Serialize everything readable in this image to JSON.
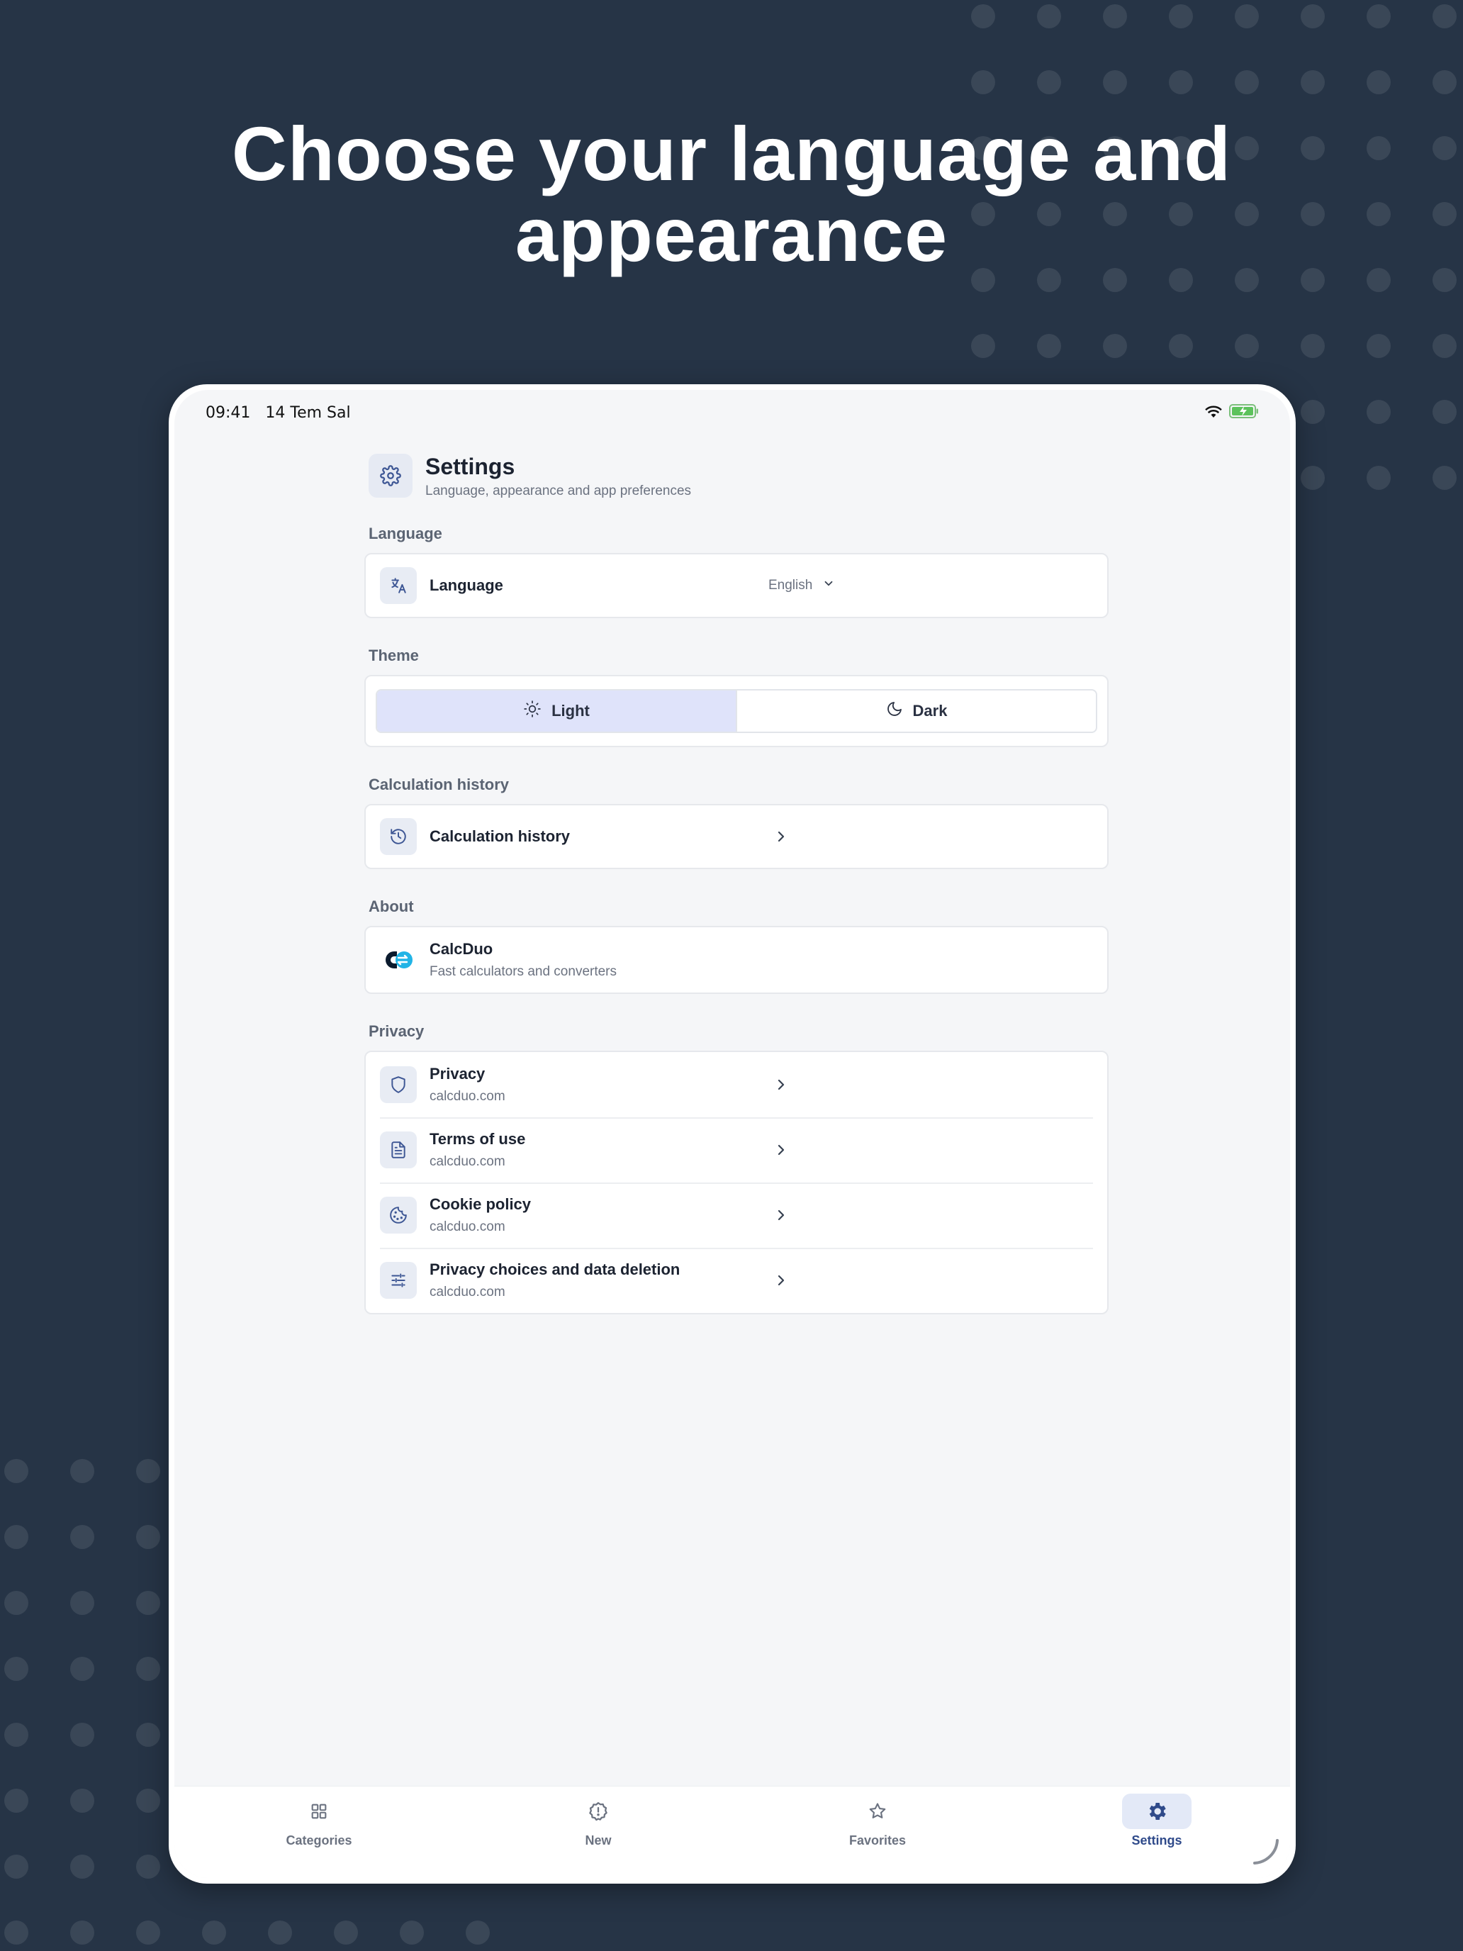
{
  "headline": {
    "line1": "Choose your language and",
    "line2": "appearance"
  },
  "status_bar": {
    "time": "09:41",
    "date": "14 Tem Sal",
    "wifi_icon": "wifi-icon",
    "battery_icon": "battery-charging-icon"
  },
  "header": {
    "icon": "gear-icon",
    "title": "Settings",
    "subtitle": "Language, appearance and app preferences"
  },
  "sections": {
    "language": {
      "label": "Language",
      "row_title": "Language",
      "value": "English",
      "icon": "translate-icon"
    },
    "theme": {
      "label": "Theme",
      "options": [
        {
          "label": "Light",
          "icon": "sun-icon",
          "selected": true
        },
        {
          "label": "Dark",
          "icon": "moon-icon",
          "selected": false
        }
      ]
    },
    "history": {
      "label": "Calculation history",
      "row_title": "Calculation history",
      "icon": "history-icon"
    },
    "about": {
      "label": "About",
      "app_name": "CalcDuo",
      "tagline": "Fast calculators and converters",
      "logo": "calcduo-logo"
    },
    "privacy": {
      "label": "Privacy",
      "items": [
        {
          "title": "Privacy",
          "sub": "calcduo.com",
          "icon": "shield-icon"
        },
        {
          "title": "Terms of use",
          "sub": "calcduo.com",
          "icon": "document-icon"
        },
        {
          "title": "Cookie policy",
          "sub": "calcduo.com",
          "icon": "cookie-icon"
        },
        {
          "title": "Privacy choices and data deletion",
          "sub": "calcduo.com",
          "icon": "sliders-icon"
        }
      ]
    }
  },
  "tabbar": {
    "tabs": [
      {
        "label": "Categories",
        "icon": "grid-icon",
        "active": false
      },
      {
        "label": "New",
        "icon": "badge-alert-icon",
        "active": false
      },
      {
        "label": "Favorites",
        "icon": "star-icon",
        "active": false
      },
      {
        "label": "Settings",
        "icon": "gear-icon",
        "active": true
      }
    ]
  },
  "colors": {
    "background": "#263446",
    "accent": "#2f4a8a",
    "selected_segment": "#dfe3fa",
    "icon_tile": "#e8ecf4"
  }
}
